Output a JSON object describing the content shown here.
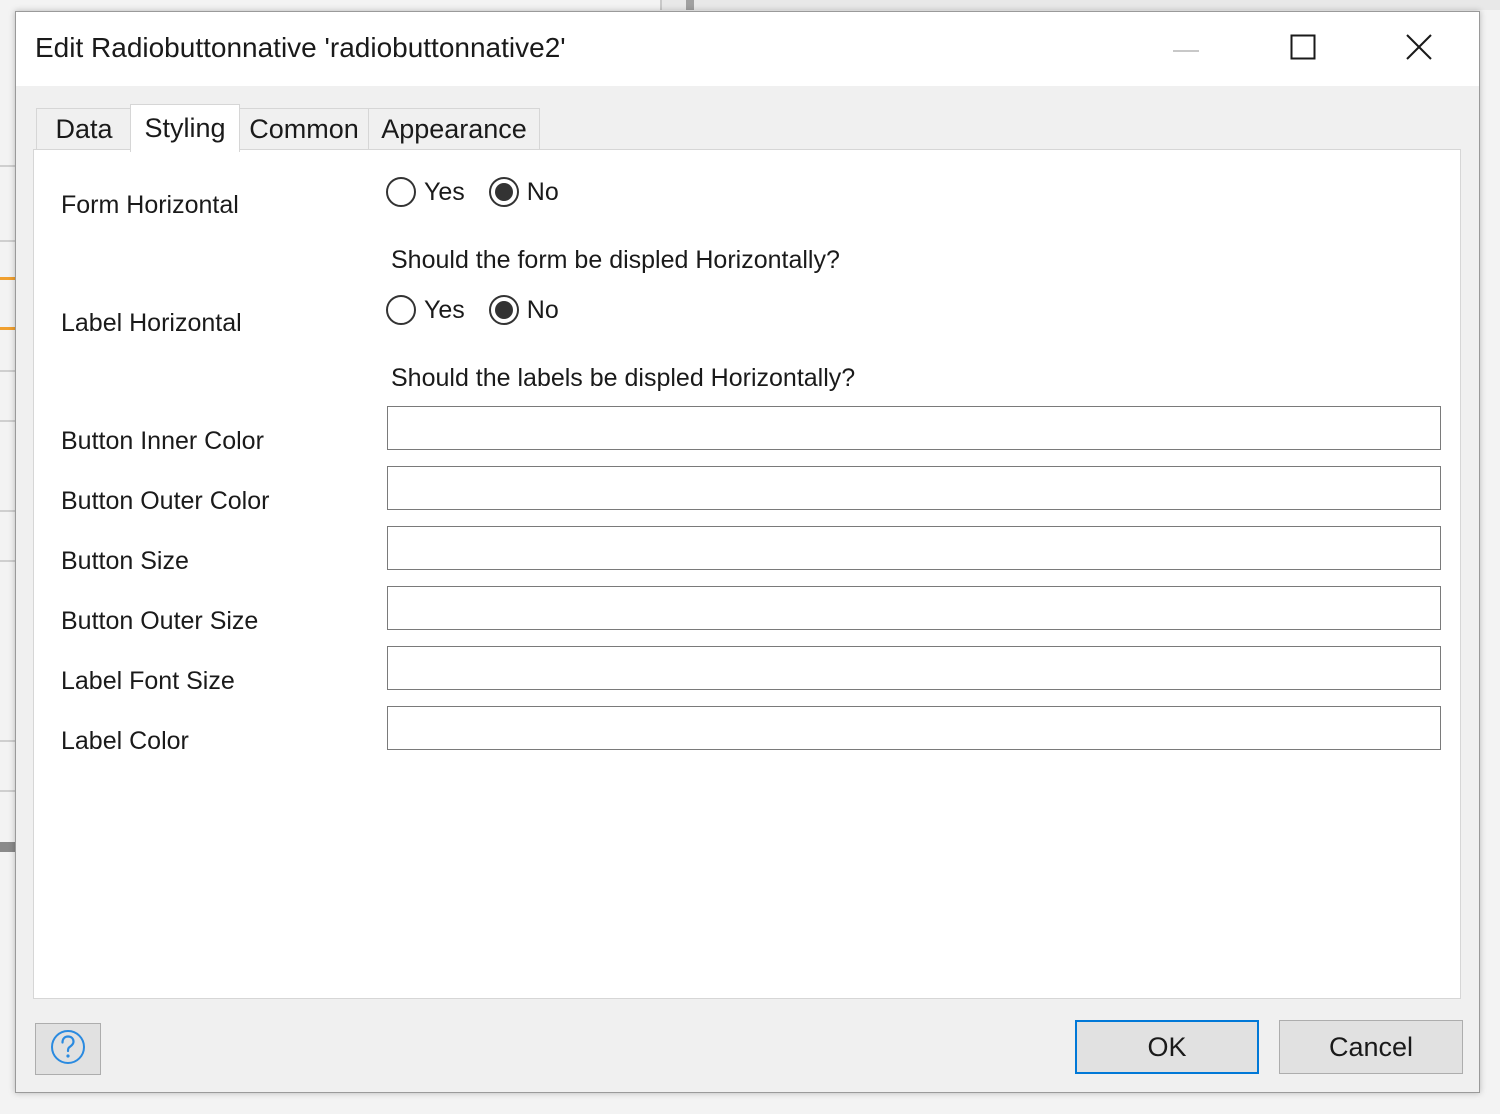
{
  "window": {
    "title": "Edit Radiobuttonnative 'radiobuttonnative2'",
    "controls": [
      "minimize-icon",
      "maximize-icon",
      "close-icon"
    ]
  },
  "tabs": [
    {
      "label": "Data",
      "active": false
    },
    {
      "label": "Styling",
      "active": true
    },
    {
      "label": "Common",
      "active": false
    },
    {
      "label": "Appearance",
      "active": false
    }
  ],
  "form": {
    "form_horizontal": {
      "label": "Form Horizontal",
      "options": [
        "Yes",
        "No"
      ],
      "selected": "No",
      "hint": "Should the form be displed Horizontally?"
    },
    "label_horizontal": {
      "label": "Label Horizontal",
      "options": [
        "Yes",
        "No"
      ],
      "selected": "No",
      "hint": "Should the labels be displed Horizontally?"
    },
    "fields": [
      {
        "label": "Button Inner Color",
        "value": ""
      },
      {
        "label": "Button Outer Color",
        "value": ""
      },
      {
        "label": "Button Size",
        "value": ""
      },
      {
        "label": "Button Outer Size",
        "value": ""
      },
      {
        "label": "Label Font Size",
        "value": ""
      },
      {
        "label": "Label Color",
        "value": ""
      }
    ]
  },
  "footer": {
    "help_icon": "help-icon",
    "ok_label": "OK",
    "cancel_label": "Cancel"
  },
  "colors": {
    "accent": "#0078d7",
    "dialog_bg": "#f0f0f0",
    "panel_bg": "#ffffff",
    "background_accent": "#f0a030"
  }
}
